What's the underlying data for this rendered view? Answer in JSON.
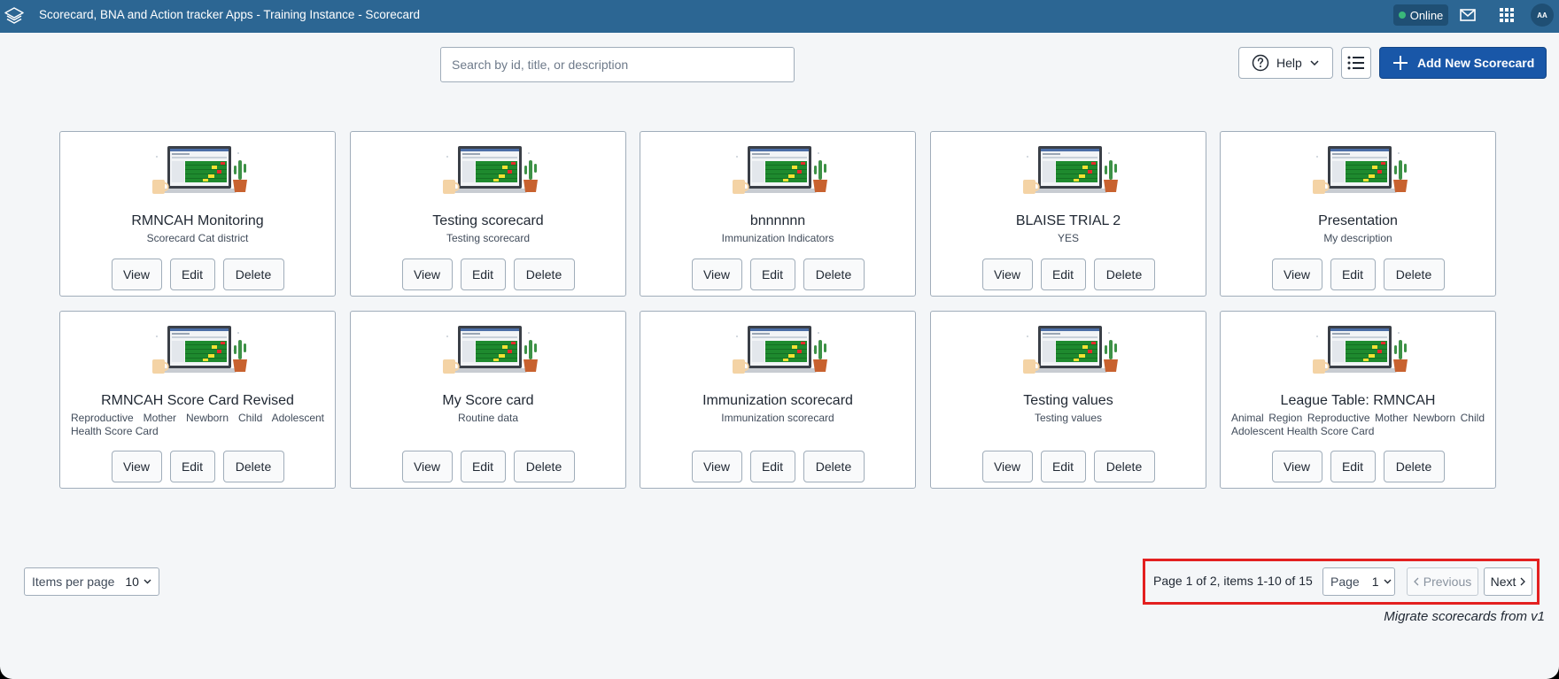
{
  "header": {
    "app_title": "Scorecard, BNA and Action tracker Apps - Training Instance - Scorecard",
    "online_label": "Online",
    "avatar_initials": "AA"
  },
  "toolbar": {
    "search_placeholder": "Search by id, title, or description",
    "help_label": "Help",
    "add_label": "Add New Scorecard"
  },
  "cards": [
    {
      "title": "RMNCAH Monitoring",
      "description": "Scorecard Cat district"
    },
    {
      "title": "Testing scorecard",
      "description": "Testing scorecard"
    },
    {
      "title": "bnnnnnn",
      "description": "Immunization Indicators"
    },
    {
      "title": "BLAISE TRIAL 2",
      "description": "YES"
    },
    {
      "title": "Presentation",
      "description": "My description"
    },
    {
      "title": "RMNCAH Score Card Revised",
      "description": "Reproductive Mother Newborn Child Adolescent Health Score Card"
    },
    {
      "title": "My Score card",
      "description": "Routine data"
    },
    {
      "title": "Immunization scorecard",
      "description": "Immunization scorecard"
    },
    {
      "title": "Testing values",
      "description": "Testing values"
    },
    {
      "title": "League Table: RMNCAH",
      "description": "Animal Region Reproductive Mother Newborn Child Adolescent Health Score Card"
    }
  ],
  "card_actions": {
    "view": "View",
    "edit": "Edit",
    "delete": "Delete"
  },
  "pagination": {
    "items_per_page_label": "Items per page",
    "items_per_page_value": "10",
    "summary": "Page 1 of 2, items 1-10 of 15",
    "page_label": "Page",
    "page_value": "1",
    "previous_label": "Previous",
    "next_label": "Next"
  },
  "footer": {
    "migrate_label": "Migrate scorecards from v1"
  },
  "colors": {
    "header_bg": "#2c6693",
    "primary_button": "#1957a8",
    "highlight": "#e32020",
    "online_dot": "#3ab77a"
  }
}
